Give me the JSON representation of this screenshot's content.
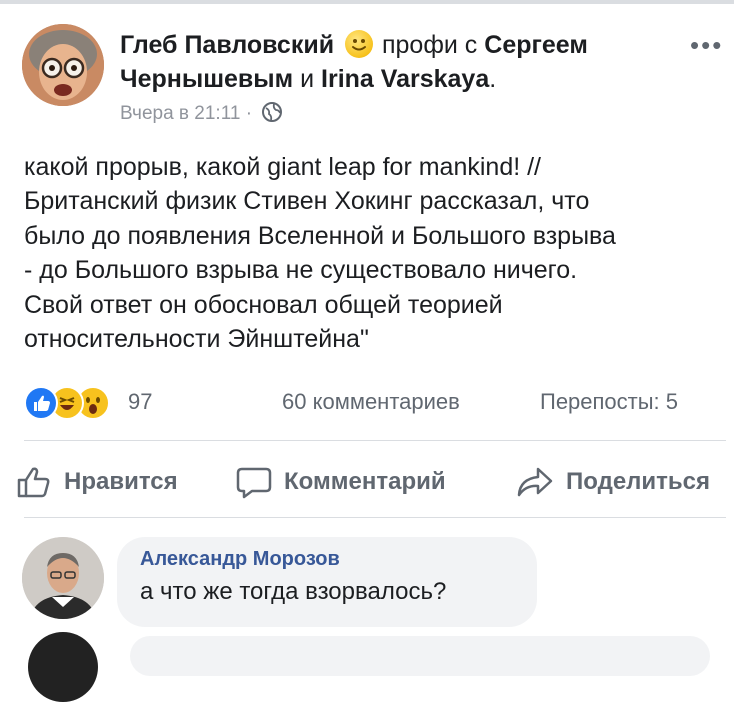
{
  "post": {
    "author": "Глеб Павловский",
    "emoji_icon": "slightly-smiling-face-icon",
    "feeling_text": "профи с",
    "tagged_1": "Сергеем",
    "tagged_1b": "Чернышевым",
    "conjunction": "и",
    "tagged_2": "Irina Varskaya",
    "tagged_2_suffix": ".",
    "more_icon": "more-options-icon",
    "more_symbol": "•••",
    "timestamp": "Вчера в 21:11",
    "separator": "·",
    "privacy_icon": "globe-icon",
    "text_lines": [
      "какой прорыв, какой giant leap for mankind! //",
      "Британский физик Стивен Хокинг рассказал, что",
      "было до появления Вселенной и Большого взрыва",
      "- до Большого взрыва не существовало ничего.",
      "Свой ответ он обосновал общей теорией",
      "относительности Эйнштейна\""
    ]
  },
  "stats": {
    "reaction_icons": [
      "like-reaction-icon",
      "haha-reaction-icon",
      "wow-reaction-icon"
    ],
    "reactions_count": "97",
    "comments": "60 комментариев",
    "shares": "Перепосты: 5"
  },
  "actions": {
    "like": "Нравится",
    "comment": "Комментарий",
    "share": "Поделиться"
  },
  "comment": {
    "author": "Александр Морозов",
    "text": "а что же тогда взорвалось?"
  },
  "colors": {
    "like_blue": "#2078f4",
    "name_link": "#385898",
    "secondary_text": "#606770",
    "meta_text": "#90949c",
    "bubble_bg": "#f2f3f5"
  }
}
